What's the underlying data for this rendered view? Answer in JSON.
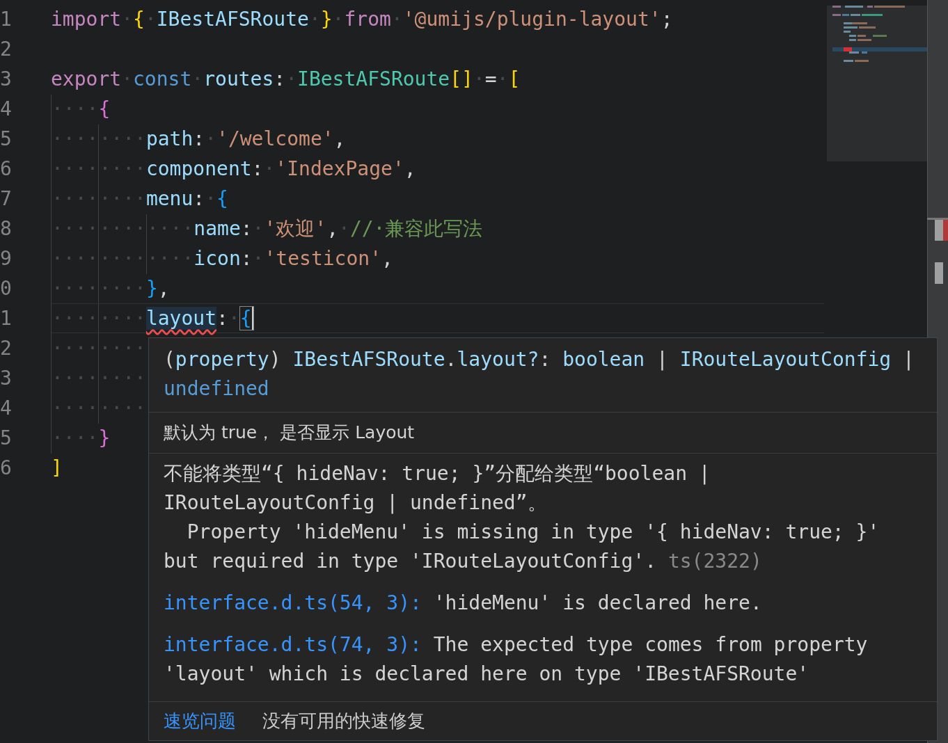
{
  "editor": {
    "lines": [
      {
        "number": "1",
        "current": false,
        "tokens": [
          {
            "kind": "keyword",
            "text": "import"
          },
          {
            "kind": "ws",
            "text": "·"
          },
          {
            "kind": "bracket1",
            "text": "{"
          },
          {
            "kind": "ws",
            "text": "·"
          },
          {
            "kind": "variable",
            "text": "IBestAFSRoute"
          },
          {
            "kind": "ws",
            "text": "·"
          },
          {
            "kind": "bracket1",
            "text": "}"
          },
          {
            "kind": "ws",
            "text": "·"
          },
          {
            "kind": "keyword",
            "text": "from"
          },
          {
            "kind": "ws",
            "text": "·"
          },
          {
            "kind": "string",
            "text": "'@umijs/plugin-layout'"
          },
          {
            "kind": "punct",
            "text": ";"
          }
        ]
      },
      {
        "number": "2",
        "current": false
      },
      {
        "number": "3",
        "current": false,
        "tokens": [
          {
            "kind": "keyword",
            "text": "export"
          },
          {
            "kind": "ws",
            "text": "·"
          },
          {
            "kind": "storage",
            "text": "const"
          },
          {
            "kind": "ws",
            "text": "·"
          },
          {
            "kind": "variable",
            "text": "routes"
          },
          {
            "kind": "punct",
            "text": ":"
          },
          {
            "kind": "ws",
            "text": "·"
          },
          {
            "kind": "type",
            "text": "IBestAFSRoute"
          },
          {
            "kind": "bracket1",
            "text": "[]"
          },
          {
            "kind": "ws",
            "text": "·"
          },
          {
            "kind": "punct",
            "text": "="
          },
          {
            "kind": "ws",
            "text": "·"
          },
          {
            "kind": "bracket1",
            "text": "["
          }
        ]
      },
      {
        "number": "4",
        "current": false,
        "tokens": [
          {
            "kind": "indent",
            "text": "····"
          },
          {
            "kind": "bracket2",
            "text": "{"
          }
        ]
      },
      {
        "number": "5",
        "current": false,
        "tokens": [
          {
            "kind": "indent",
            "text": "····"
          },
          {
            "kind": "indent",
            "text": "····"
          },
          {
            "kind": "property",
            "text": "path"
          },
          {
            "kind": "punct",
            "text": ":"
          },
          {
            "kind": "ws",
            "text": "·"
          },
          {
            "kind": "string",
            "text": "'/welcome'"
          },
          {
            "kind": "punct",
            "text": ","
          }
        ]
      },
      {
        "number": "6",
        "current": false,
        "tokens": [
          {
            "kind": "indent",
            "text": "····"
          },
          {
            "kind": "indent",
            "text": "····"
          },
          {
            "kind": "property",
            "text": "component"
          },
          {
            "kind": "punct",
            "text": ":"
          },
          {
            "kind": "ws",
            "text": "·"
          },
          {
            "kind": "string",
            "text": "'IndexPage'"
          },
          {
            "kind": "punct",
            "text": ","
          }
        ]
      },
      {
        "number": "7",
        "current": false,
        "tokens": [
          {
            "kind": "indent",
            "text": "····"
          },
          {
            "kind": "indent",
            "text": "····"
          },
          {
            "kind": "property",
            "text": "menu"
          },
          {
            "kind": "punct",
            "text": ":"
          },
          {
            "kind": "ws",
            "text": "·"
          },
          {
            "kind": "bracket3",
            "text": "{"
          }
        ]
      },
      {
        "number": "8",
        "current": false,
        "tokens": [
          {
            "kind": "indent",
            "text": "····"
          },
          {
            "kind": "indent",
            "text": "····"
          },
          {
            "kind": "indent",
            "text": "····"
          },
          {
            "kind": "property",
            "text": "name"
          },
          {
            "kind": "punct",
            "text": ":"
          },
          {
            "kind": "ws",
            "text": "·"
          },
          {
            "kind": "string",
            "text": "'欢迎'"
          },
          {
            "kind": "punct",
            "text": ","
          },
          {
            "kind": "ws",
            "text": "·"
          },
          {
            "kind": "comment",
            "text": "//·兼容此写法"
          }
        ]
      },
      {
        "number": "9",
        "current": false,
        "tokens": [
          {
            "kind": "indent",
            "text": "····"
          },
          {
            "kind": "indent",
            "text": "····"
          },
          {
            "kind": "indent",
            "text": "····"
          },
          {
            "kind": "property",
            "text": "icon"
          },
          {
            "kind": "punct",
            "text": ":"
          },
          {
            "kind": "ws",
            "text": "·"
          },
          {
            "kind": "string",
            "text": "'testicon'"
          },
          {
            "kind": "punct",
            "text": ","
          }
        ]
      },
      {
        "number": "0",
        "current": false,
        "tokens": [
          {
            "kind": "indent",
            "text": "····"
          },
          {
            "kind": "indent",
            "text": "····"
          },
          {
            "kind": "bracket3",
            "text": "}"
          },
          {
            "kind": "punct",
            "text": ","
          }
        ]
      },
      {
        "number": "1",
        "current": true,
        "tokens": [
          {
            "kind": "indent",
            "text": "····"
          },
          {
            "kind": "indent",
            "text": "····"
          },
          {
            "kind": "property",
            "text": "layout",
            "error": true
          },
          {
            "kind": "punct",
            "text": ":"
          },
          {
            "kind": "ws",
            "text": "·"
          },
          {
            "kind": "bracket3",
            "text": "{",
            "matched": true
          }
        ]
      },
      {
        "number": "2",
        "current": false,
        "tokens": [
          {
            "kind": "indent",
            "text": "····"
          },
          {
            "kind": "indent",
            "text": "····"
          }
        ]
      },
      {
        "number": "3",
        "current": false,
        "tokens": [
          {
            "kind": "indent",
            "text": "····"
          },
          {
            "kind": "indent",
            "text": "····"
          }
        ]
      },
      {
        "number": "4",
        "current": false,
        "tokens": [
          {
            "kind": "indent",
            "text": "····"
          },
          {
            "kind": "indent",
            "text": "····"
          }
        ]
      },
      {
        "number": "5",
        "current": false,
        "tokens": [
          {
            "kind": "indent",
            "text": "····"
          },
          {
            "kind": "bracket2",
            "text": "}"
          }
        ]
      },
      {
        "number": "6",
        "current": false,
        "tokens": [
          {
            "kind": "bracket1",
            "text": "]"
          }
        ]
      }
    ]
  },
  "hover": {
    "signature": [
      [
        {
          "kind": "punct",
          "text": "("
        },
        {
          "kind": "property",
          "text": "property"
        },
        {
          "kind": "punct",
          "text": ") "
        },
        {
          "kind": "property",
          "text": "IBestAFSRoute"
        },
        {
          "kind": "punct",
          "text": "."
        },
        {
          "kind": "property",
          "text": "layout?"
        },
        {
          "kind": "punct",
          "text": ": "
        },
        {
          "kind": "property",
          "text": "boolean"
        },
        {
          "kind": "punct",
          "text": " | "
        },
        {
          "kind": "property",
          "text": "IRouteLayoutConfig"
        },
        {
          "kind": "punct",
          "text": " |"
        }
      ],
      [
        {
          "kind": "storage",
          "text": "undefined"
        }
      ]
    ],
    "doc": "默认为 true， 是否显示 Layout",
    "error": {
      "lines": [
        "不能将类型“{ hideNav: true; }”分配给类型“boolean |",
        "IRouteLayoutConfig | undefined”。",
        "  Property 'hideMenu' is missing in type '{ hideNav: true; }'",
        "but required in type 'IRouteLayoutConfig'. "
      ],
      "code": "ts(2322)"
    },
    "related": [
      {
        "link": "interface.d.ts(54, 3):",
        "lines": [
          " 'hideMenu' is declared here."
        ]
      },
      {
        "link": "interface.d.ts(74, 3):",
        "lines": [
          " The expected type comes from property",
          "'layout' which is declared here on type 'IBestAFSRoute'"
        ]
      }
    ],
    "footer": {
      "action": "速览问题",
      "message": "没有可用的快速修复"
    }
  }
}
